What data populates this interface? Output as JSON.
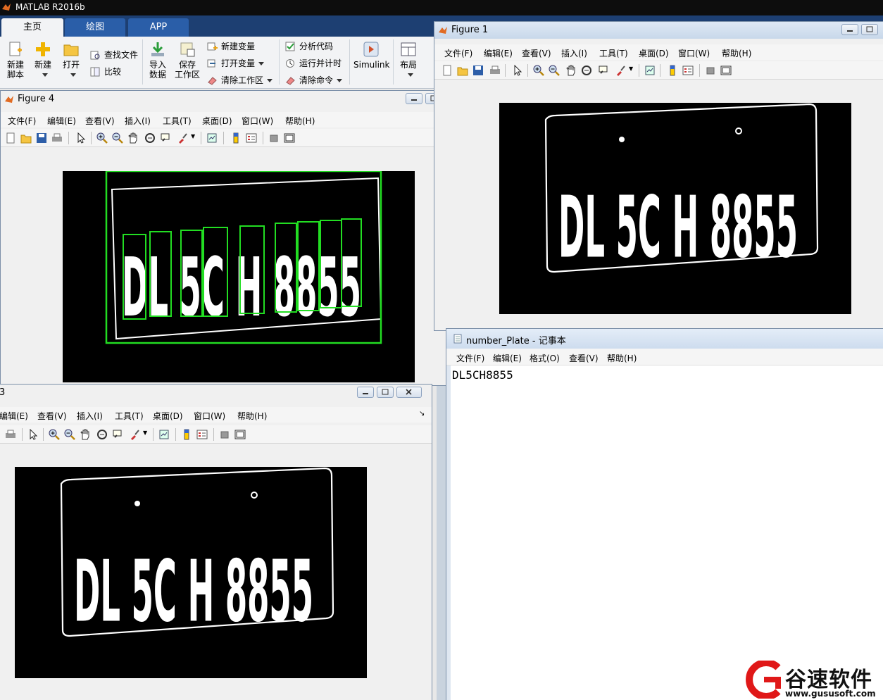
{
  "app_title": "MATLAB R2016b",
  "ribbon_tabs": [
    {
      "label": "主页"
    },
    {
      "label": "绘图"
    },
    {
      "label": "APP"
    }
  ],
  "ribbon": {
    "new_script": [
      "新建",
      "脚本"
    ],
    "new": "新建",
    "open": "打开",
    "find_files": "查找文件",
    "compare": "比较",
    "import_data": [
      "导入",
      "数据"
    ],
    "save_workspace": [
      "保存",
      "工作区"
    ],
    "new_variable": "新建变量",
    "open_variable": "打开变量",
    "clear_workspace": "清除工作区",
    "analyze_code": "分析代码",
    "run_and_time": "运行并计时",
    "clear_commands": "清除命令",
    "simulink": "Simulink",
    "layout": "布局"
  },
  "figure_menu": [
    "文件(F)",
    "编辑(E)",
    "查看(V)",
    "插入(I)",
    "工具(T)",
    "桌面(D)",
    "窗口(W)",
    "帮助(H)"
  ],
  "figure_menu_partial": [
    "编辑(E)",
    "查看(V)",
    "插入(I)",
    "工具(T)",
    "桌面(D)",
    "窗口(W)",
    "帮助(H)"
  ],
  "figure1": {
    "title": "Figure 1"
  },
  "figure4": {
    "title": "Figure 4"
  },
  "figure3": {
    "title_fragment": "3"
  },
  "plate": {
    "characters": [
      "D",
      "L",
      "5",
      "C",
      "H",
      "8",
      "8",
      "5",
      "5"
    ],
    "display": [
      "DL",
      "5C",
      "H",
      "8855"
    ]
  },
  "notepad": {
    "title": "number_Plate - 记事本",
    "menu": [
      "文件(F)",
      "编辑(E)",
      "格式(O)",
      "查看(V)",
      "帮助(H)"
    ],
    "content": "DL5CH8855"
  },
  "colors": {
    "bbox": "#22dd22",
    "plate_bg": "#000000",
    "plate_fg": "#ffffff",
    "ribbon_dark": "#1d3f72"
  },
  "watermark": {
    "name": "谷速软件",
    "url": "www.gususoft.com"
  }
}
